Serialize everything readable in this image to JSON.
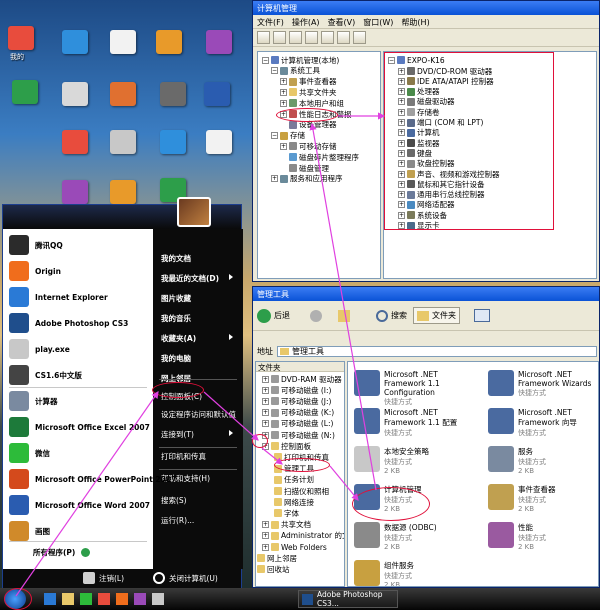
{
  "desktop": {
    "icons": [
      {
        "label": "我的"
      }
    ],
    "tile_colors": [
      "#e84c3d",
      "#2f8fdc",
      "#f2f2f2",
      "#e89a2a",
      "#9a4ab8",
      "#2d9e4a",
      "#d9d9d9",
      "#e07030",
      "#6a6a6a"
    ]
  },
  "computer_management": {
    "title": "计算机管理",
    "menu": [
      "文件(F)",
      "操作(A)",
      "查看(V)",
      "窗口(W)",
      "帮助(H)"
    ],
    "tree": [
      {
        "label": "计算机管理(本地)",
        "level": 0,
        "exp": "−"
      },
      {
        "label": "系统工具",
        "level": 1,
        "exp": "−"
      },
      {
        "label": "事件查看器",
        "level": 2,
        "exp": "+"
      },
      {
        "label": "共享文件夹",
        "level": 2,
        "exp": "+"
      },
      {
        "label": "本地用户和组",
        "level": 2,
        "exp": "+"
      },
      {
        "label": "性能日志和警报",
        "level": 2,
        "exp": "+"
      },
      {
        "label": "设备管理器",
        "level": 2,
        "exp": ""
      },
      {
        "label": "存储",
        "level": 1,
        "exp": "−"
      },
      {
        "label": "可移动存储",
        "level": 2,
        "exp": "+"
      },
      {
        "label": "磁盘碎片整理程序",
        "level": 2,
        "exp": ""
      },
      {
        "label": "磁盘管理",
        "level": 2,
        "exp": ""
      },
      {
        "label": "服务和应用程序",
        "level": 1,
        "exp": "+"
      }
    ],
    "devices_root": "EXPO-K16",
    "devices": [
      "DVD/CD-ROM 驱动器",
      "IDE ATA/ATAPI 控制器",
      "处理器",
      "磁盘驱动器",
      "存储卷",
      "端口 (COM 和 LPT)",
      "计算机",
      "监视器",
      "键盘",
      "软盘控制器",
      "声音、视频和游戏控制器",
      "鼠标和其它指针设备",
      "通用串行总线控制器",
      "网络适配器",
      "系统设备",
      "显示卡"
    ]
  },
  "explorer": {
    "title": "管理工具",
    "back_label": "后退",
    "search_label": "搜索",
    "folders_label": "文件夹",
    "address_label": "地址",
    "address_value": "管理工具",
    "pane_header": "文件夹",
    "tree": [
      {
        "label": "DVD-RAM 驱动器 (",
        "level": 0
      },
      {
        "label": "可移动磁盘 (I:)",
        "level": 0
      },
      {
        "label": "可移动磁盘 (J:)",
        "level": 0
      },
      {
        "label": "可移动磁盘 (K:)",
        "level": 0
      },
      {
        "label": "可移动磁盘 (L:)",
        "level": 0
      },
      {
        "label": "可移动磁盘 (N:)",
        "level": 0
      },
      {
        "label": "控制面板",
        "level": 0
      },
      {
        "label": "打印机和传真",
        "level": 1
      },
      {
        "label": "管理工具",
        "level": 1
      },
      {
        "label": "任务计划",
        "level": 1
      },
      {
        "label": "扫描仪和照相",
        "level": 1
      },
      {
        "label": "网络连接",
        "level": 1
      },
      {
        "label": "字体",
        "level": 1
      },
      {
        "label": "共享文档",
        "level": 0
      },
      {
        "label": "Administrator 的文",
        "level": 0
      },
      {
        "label": "Web Folders",
        "level": 0
      },
      {
        "label": "网上邻居",
        "level": -1
      },
      {
        "label": "回收站",
        "level": -1
      }
    ],
    "items": [
      {
        "name": "Microsoft .NET Framework 1.1 Configuration",
        "type": "快捷方式",
        "size": ""
      },
      {
        "name": "Microsoft .NET Framework Wizards",
        "type": "快捷方式",
        "size": ""
      },
      {
        "name": "Microsoft .NET Framework 1.1 配置",
        "type": "快捷方式",
        "size": ""
      },
      {
        "name": "Microsoft .NET Framework 向导",
        "type": "快捷方式",
        "size": ""
      },
      {
        "name": "本地安全策略",
        "type": "快捷方式",
        "size": "2 KB"
      },
      {
        "name": "服务",
        "type": "快捷方式",
        "size": "2 KB"
      },
      {
        "name": "计算机管理",
        "type": "快捷方式",
        "size": "2 KB"
      },
      {
        "name": "事件查看器",
        "type": "快捷方式",
        "size": "2 KB"
      },
      {
        "name": "数据源 (ODBC)",
        "type": "快捷方式",
        "size": "2 KB"
      },
      {
        "name": "性能",
        "type": "快捷方式",
        "size": "2 KB"
      },
      {
        "name": "组件服务",
        "type": "快捷方式",
        "size": "2 KB"
      }
    ]
  },
  "start_menu": {
    "pinned": [
      {
        "label": "腾讯QQ",
        "color": "#2b2b2b"
      },
      {
        "label": "Origin",
        "color": "#f06d1c"
      },
      {
        "label": "Internet Explorer",
        "color": "#2a7ad6"
      },
      {
        "label": "Adobe Photoshop CS3",
        "color": "#1f4e8c"
      },
      {
        "label": "play.exe",
        "color": "#c8c8c8"
      },
      {
        "label": "CS1.6中文版",
        "color": "#444444"
      },
      {
        "label": "计算器",
        "color": "#7a8aa0"
      },
      {
        "label": "Microsoft Office Excel 2007",
        "color": "#1d7a3a"
      },
      {
        "label": "微信",
        "color": "#2dbb3a"
      },
      {
        "label": "Microsoft Office PowerPoint 2007",
        "color": "#d44a1c"
      },
      {
        "label": "Microsoft Office Word 2007",
        "color": "#2a5cb0"
      },
      {
        "label": "画图",
        "color": "#d08a2a"
      }
    ],
    "all_programs": "所有程序(P)",
    "right": [
      "我的文档",
      "我最近的文档(D)",
      "图片收藏",
      "我的音乐",
      "收藏夹(A)",
      "我的电脑",
      "网上邻居",
      "控制面板(C)",
      "设定程序访问和默认值",
      "连接到(T)",
      "打印机和传真",
      "帮助和支持(H)",
      "搜索(S)",
      "运行(R)..."
    ],
    "logoff": "注销(L)",
    "shutdown": "关闭计算机(U)"
  },
  "taskbar": {
    "task_label": "Adobe Photoshop CS3..."
  },
  "annotation_color": "#e0103a"
}
